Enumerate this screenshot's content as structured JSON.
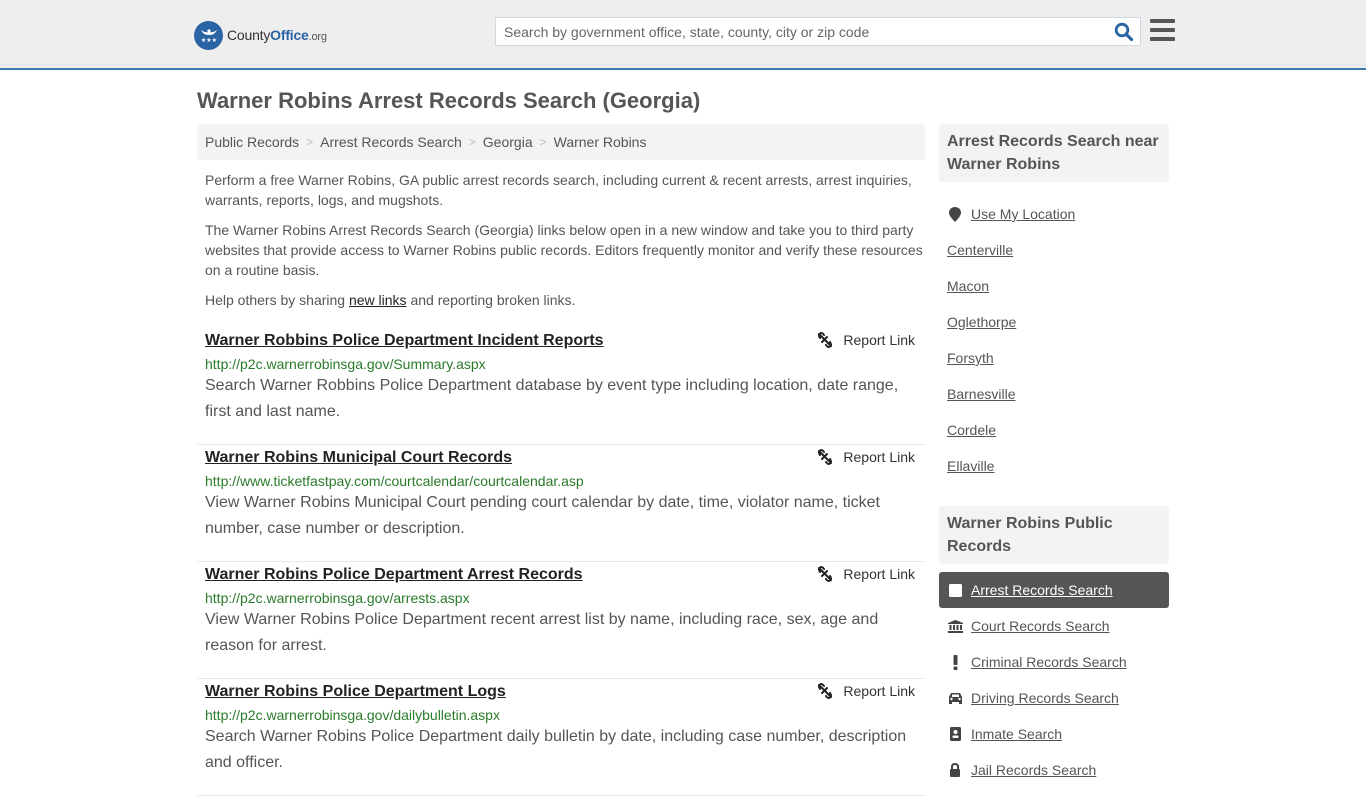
{
  "header": {
    "logo": {
      "brand_part1": "County",
      "brand_part2": "Office",
      "brand_suffix": ".org"
    },
    "search": {
      "placeholder": "Search by government office, state, county, city or zip code",
      "value": ""
    },
    "icons": {
      "search": "search-icon",
      "menu": "hamburger-menu-icon"
    }
  },
  "page": {
    "title": "Warner Robins Arrest Records Search (Georgia)",
    "breadcrumb": [
      "Public Records",
      "Arrest Records Search",
      "Georgia",
      "Warner Robins"
    ],
    "intro": {
      "p1": "Perform a free Warner Robins, GA public arrest records search, including current & recent arrests, arrest inquiries, warrants, reports, logs, and mugshots.",
      "p2": "The Warner Robins Arrest Records Search (Georgia) links below open in a new window and take you to third party websites that provide access to Warner Robins public records. Editors frequently monitor and verify these resources on a routine basis.",
      "p3_before": "Help others by sharing ",
      "p3_link": "new links",
      "p3_after": " and reporting broken links."
    }
  },
  "listings": [
    {
      "title": "Warner Robbins Police Department Incident Reports",
      "url": "http://p2c.warnerrobinsga.gov/Summary.aspx",
      "description": "Search Warner Robbins Police Department database by event type including location, date range, first and last name.",
      "report_label": "Report Link"
    },
    {
      "title": "Warner Robins Municipal Court Records",
      "url": "http://www.ticketfastpay.com/courtcalendar/courtcalendar.asp",
      "description": "View Warner Robins Municipal Court pending court calendar by date, time, violator name, ticket number, case number or description.",
      "report_label": "Report Link"
    },
    {
      "title": "Warner Robins Police Department Arrest Records",
      "url": "http://p2c.warnerrobinsga.gov/arrests.aspx",
      "description": "View Warner Robins Police Department recent arrest list by name, including race, sex, age and reason for arrest.",
      "report_label": "Report Link"
    },
    {
      "title": "Warner Robins Police Department Logs",
      "url": "http://p2c.warnerrobinsga.gov/dailybulletin.aspx",
      "description": "Search Warner Robins Police Department daily bulletin by date, including case number, description and officer.",
      "report_label": "Report Link"
    }
  ],
  "sidebar": {
    "nearby": {
      "heading": "Arrest Records Search near Warner Robins",
      "use_location": "Use My Location",
      "cities": [
        "Centerville",
        "Macon",
        "Oglethorpe",
        "Forsyth",
        "Barnesville",
        "Cordele",
        "Ellaville"
      ]
    },
    "public_records": {
      "heading": "Warner Robins Public Records",
      "items": [
        {
          "label": "Arrest Records Search",
          "icon": "square-icon",
          "active": true
        },
        {
          "label": "Court Records Search",
          "icon": "courthouse-icon",
          "active": false
        },
        {
          "label": "Criminal Records Search",
          "icon": "exclamation-icon",
          "active": false
        },
        {
          "label": "Driving Records Search",
          "icon": "car-icon",
          "active": false
        },
        {
          "label": "Inmate Search",
          "icon": "id-badge-icon",
          "active": false
        },
        {
          "label": "Jail Records Search",
          "icon": "lock-icon",
          "active": false
        }
      ]
    }
  },
  "colors": {
    "brand_blue": "#2a64a4",
    "header_bg": "#eeeeee",
    "header_border": "#3a7cb0",
    "url_green": "#2a7a2a",
    "active_bg": "#555555"
  }
}
